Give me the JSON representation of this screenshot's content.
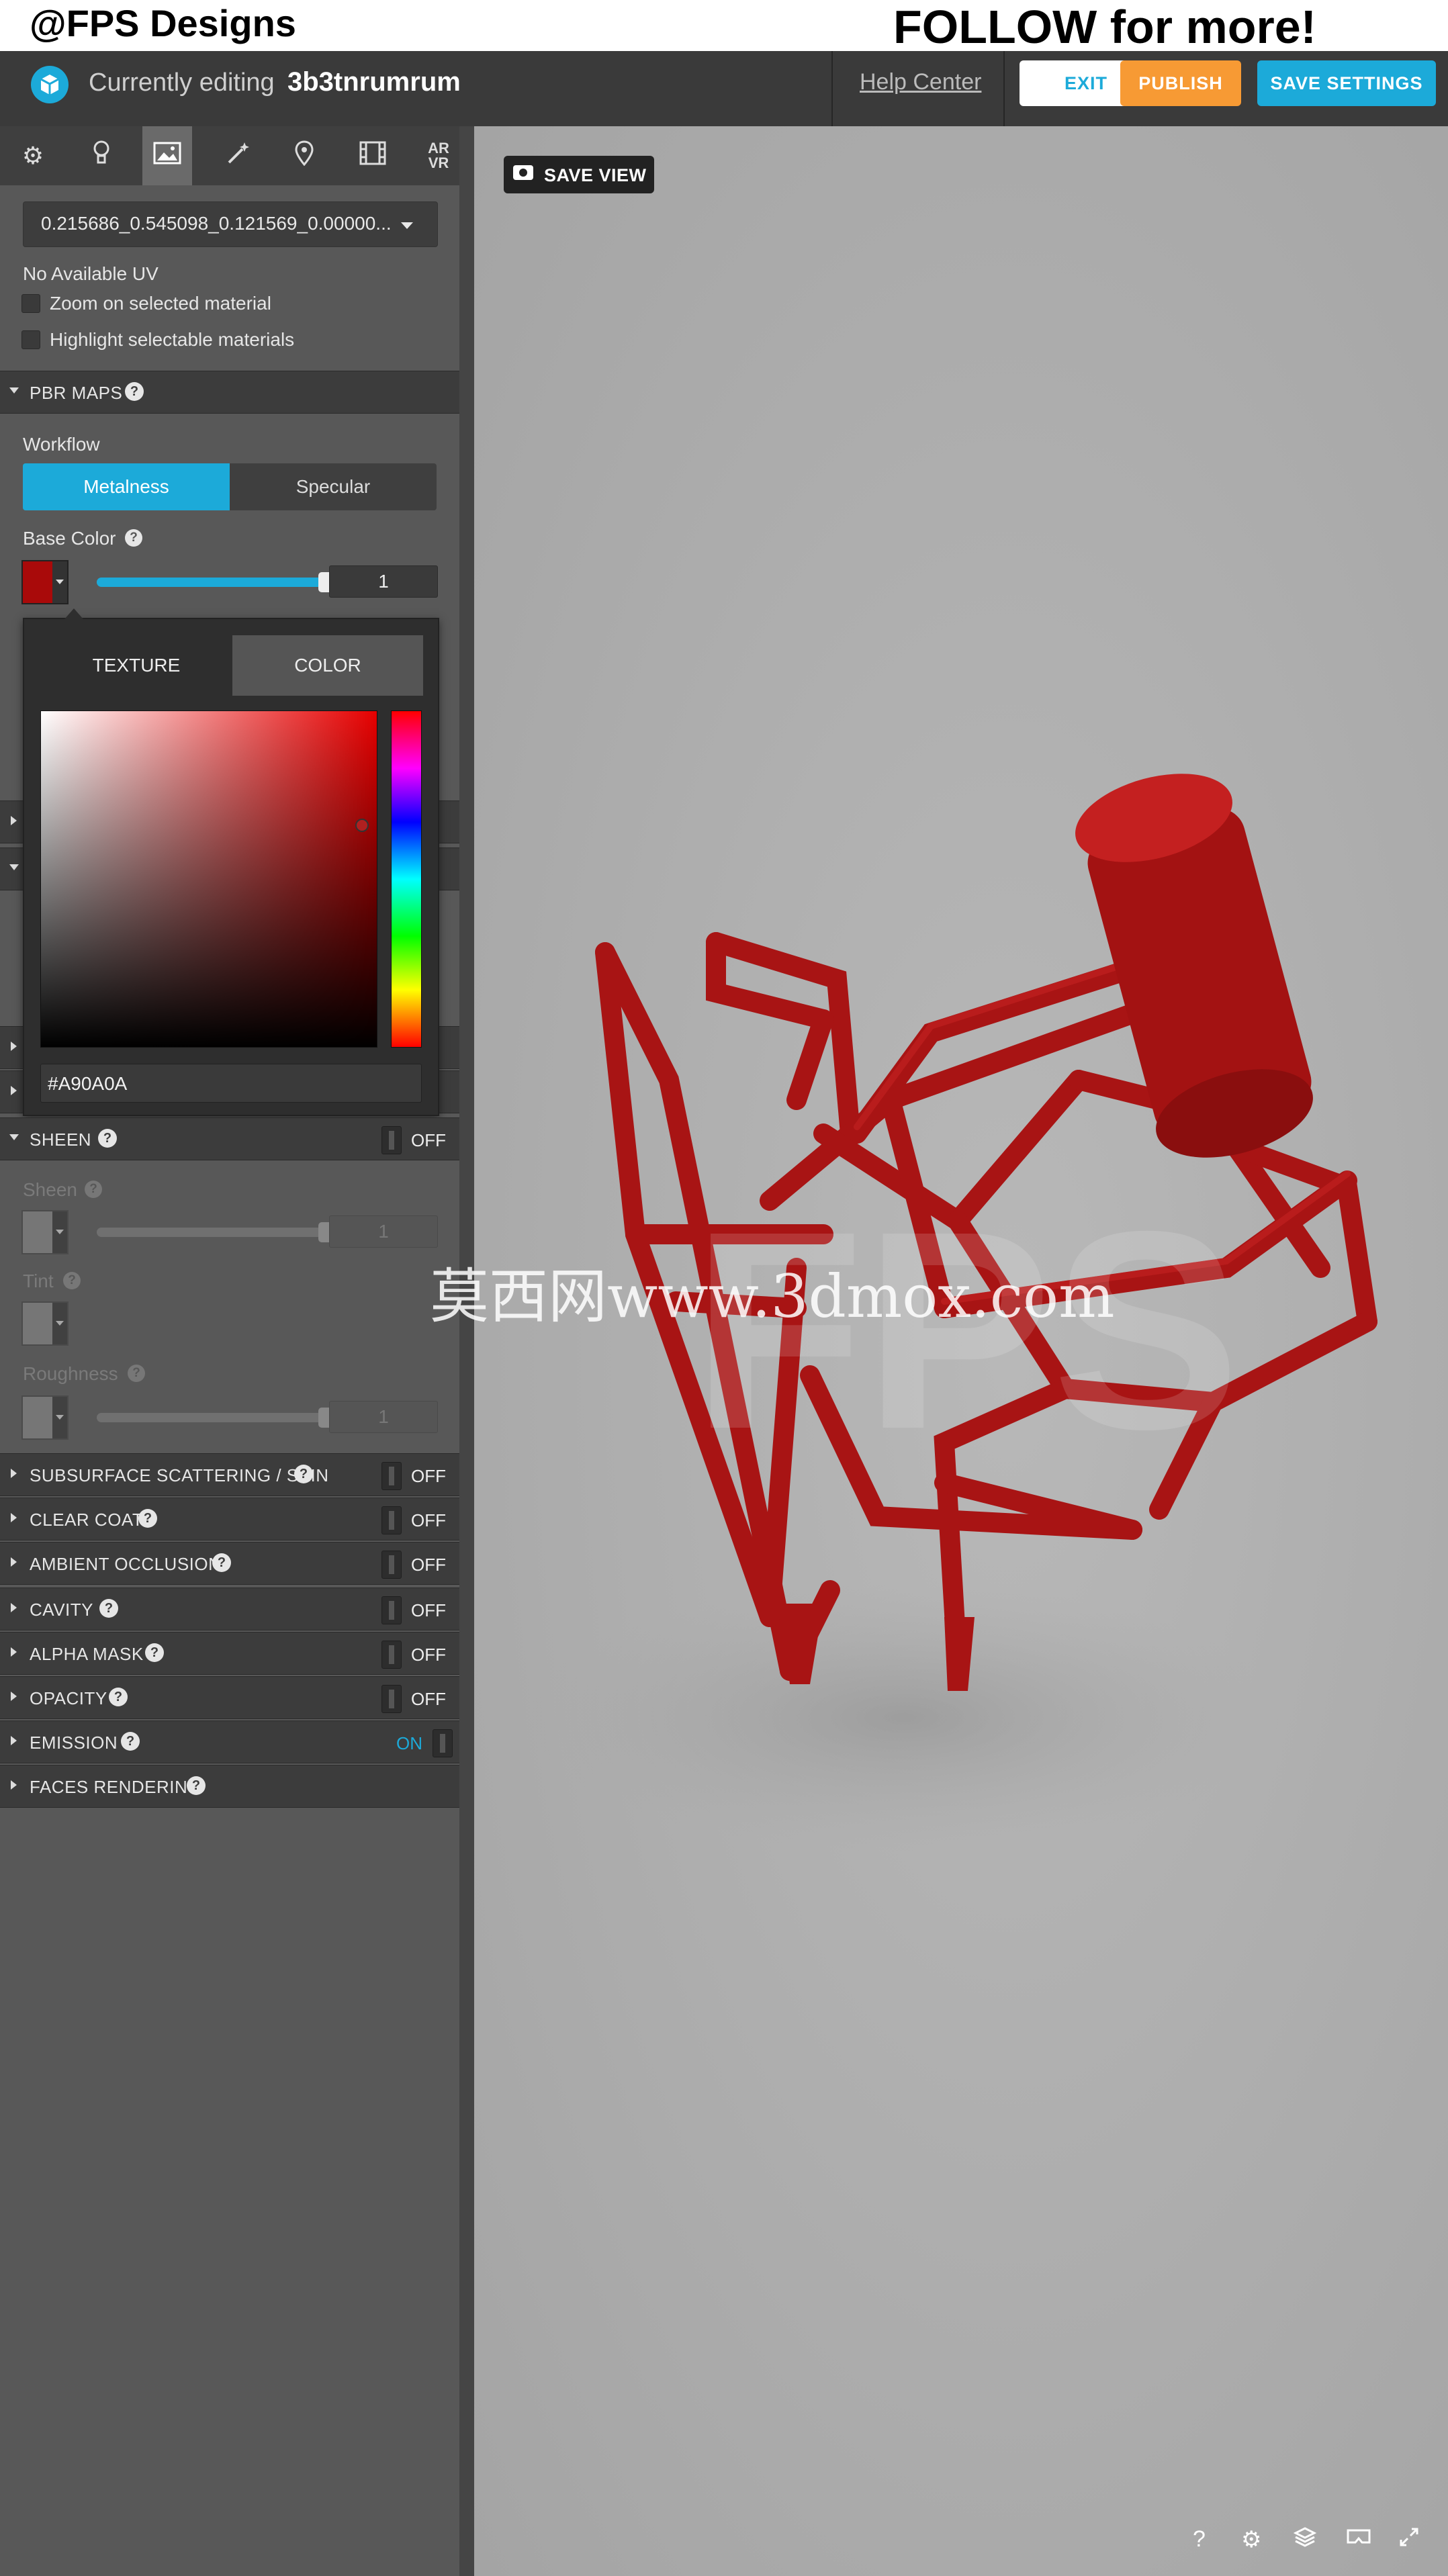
{
  "overlay": {
    "brand_text": "@FPS Designs",
    "cta_text": "FOLLOW for more!",
    "watermark_text": "莫西网www.3dmox.com",
    "watermark_faint": "FPS"
  },
  "header": {
    "editing_label": "Currently editing",
    "model_name": "3b3tnrumrum",
    "help_label": "Help Center",
    "exit_label": "EXIT",
    "publish_label": "PUBLISH",
    "save_settings_label": "SAVE SETTINGS"
  },
  "tabs": {
    "ar_vr_label_1": "AR",
    "ar_vr_label_2": "VR"
  },
  "material": {
    "selected": "0.215686_0.545098_0.121569_0.00000...",
    "uv_status": "No Available UV",
    "zoom_label": "Zoom on selected material",
    "highlight_label": "Highlight selectable materials"
  },
  "pbr": {
    "section_label": "PBR MAPS",
    "workflow_label": "Workflow",
    "metalness_label": "Metalness",
    "specular_label": "Specular",
    "base_color_label": "Base Color",
    "base_color_value": "1",
    "base_color_hex": "#A90A0A"
  },
  "picker": {
    "texture_tab": "TEXTURE",
    "color_tab": "COLOR",
    "hex": "#A90A0A"
  },
  "sheen": {
    "section_label": "SHEEN",
    "state": "OFF",
    "sheen_label": "Sheen",
    "sheen_value": "1",
    "tint_label": "Tint",
    "roughness_label": "Roughness",
    "roughness_value": "1"
  },
  "sections": {
    "sss": {
      "label": "SUBSURFACE SCATTERING / SKIN",
      "state": "OFF"
    },
    "clear_coat": {
      "label": "CLEAR COAT",
      "state": "OFF"
    },
    "ao": {
      "label": "AMBIENT OCCLUSION",
      "state": "OFF"
    },
    "cavity": {
      "label": "CAVITY",
      "state": "OFF"
    },
    "alpha": {
      "label": "ALPHA MASK",
      "state": "OFF"
    },
    "opacity": {
      "label": "OPACITY",
      "state": "OFF"
    },
    "emission": {
      "label": "EMISSION",
      "state": "ON"
    },
    "faces": {
      "label": "FACES RENDERING"
    }
  },
  "viewport": {
    "save_view_label": "SAVE VIEW",
    "bottom_icons": [
      "help-icon",
      "settings-icon",
      "layers-icon",
      "vr-icon",
      "fullscreen-icon"
    ],
    "help_glyph": "?"
  },
  "colors": {
    "accent": "#1caad9",
    "publish": "#f79a34",
    "model_red": "#b01818"
  }
}
